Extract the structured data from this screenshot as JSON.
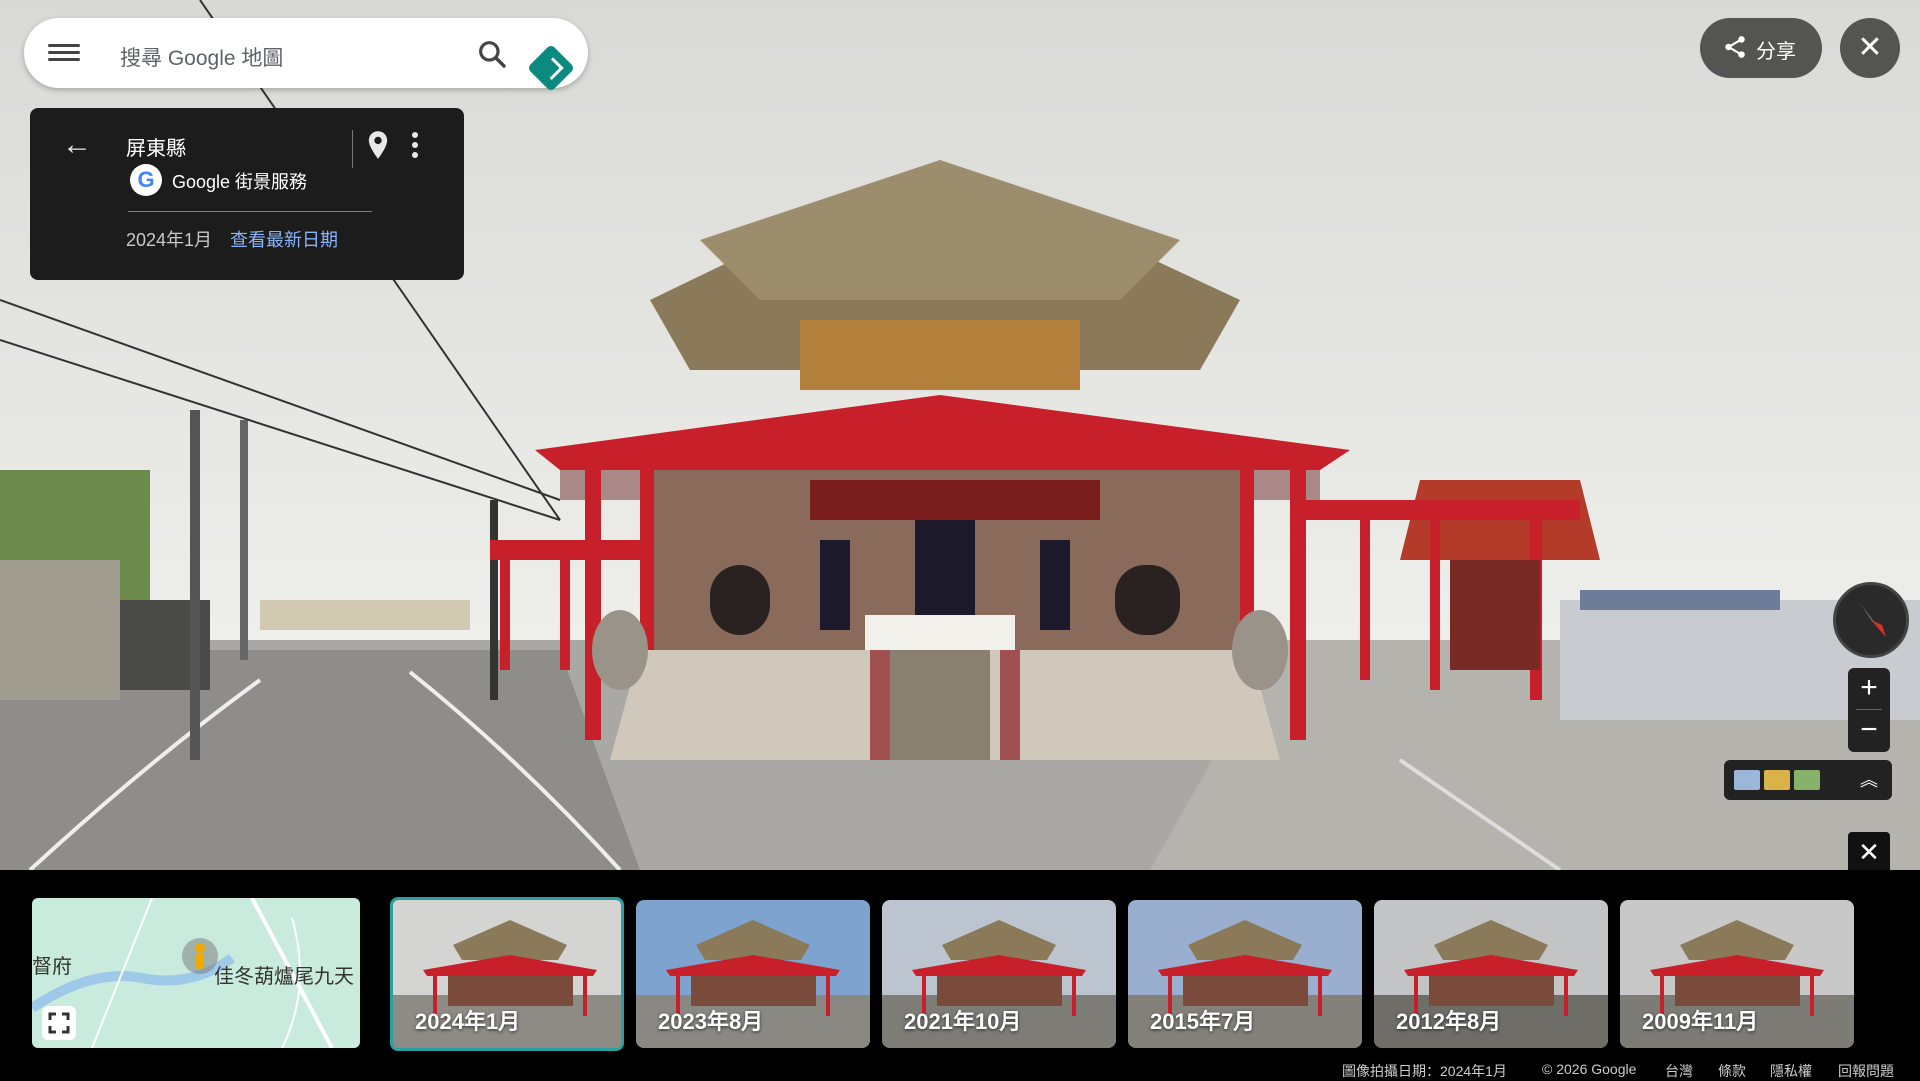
{
  "search": {
    "placeholder": "搜尋 Google 地圖"
  },
  "card": {
    "location": "屏東縣",
    "provider": "Google 街景服務",
    "capture_date": "2024年1月",
    "latest_link": "查看最新日期"
  },
  "share": {
    "label": "分享"
  },
  "close": {
    "label": "✕"
  },
  "zoom": {
    "in": "+",
    "out": "−"
  },
  "timeline_close": {
    "label": "✕"
  },
  "minimap": {
    "label_left": "督府",
    "label_place": "佳冬葫爐尾九天"
  },
  "thumbnails": [
    {
      "label": "2024年1月",
      "selected": true
    },
    {
      "label": "2023年8月",
      "selected": false
    },
    {
      "label": "2021年10月",
      "selected": false
    },
    {
      "label": "2015年7月",
      "selected": false
    },
    {
      "label": "2012年8月",
      "selected": false
    },
    {
      "label": "2009年11月",
      "selected": false
    }
  ],
  "footer": {
    "capture": "圖像拍攝日期：2024年1月",
    "copyright": "© 2026 Google",
    "region": "台灣",
    "terms": "條款",
    "privacy": "隱私權",
    "report": "回報問題"
  },
  "colors": {
    "accent_teal": "#0b8a7f",
    "link_blue": "#8ab4f8",
    "temple_red": "#c8202a",
    "selected_border": "#2aa0a0"
  }
}
